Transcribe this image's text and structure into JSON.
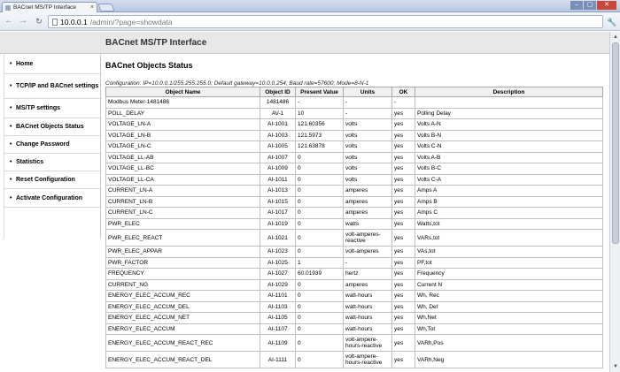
{
  "browser": {
    "tab_title": "BACnet MS/TP Interface",
    "tab_close": "×",
    "url_host": "10.0.0.1",
    "url_path": "/admin/?page=showdata",
    "back_icon": "←",
    "forward_icon": "→",
    "reload_icon": "↻",
    "wrench_icon": "🔧",
    "win_min": "–",
    "win_max": "▢",
    "win_close": "✕"
  },
  "header": {
    "brand": "BACnet MS/TP Interface"
  },
  "sidebar": {
    "items": [
      {
        "label": "Home"
      },
      {
        "label": "TCP/IP and BACnet settings"
      },
      {
        "label": "MS/TP settings"
      },
      {
        "label": "BACnet Objects Status"
      },
      {
        "label": "Change Password"
      },
      {
        "label": "Statistics"
      },
      {
        "label": "Reset Configuration"
      },
      {
        "label": "Activate Configuration"
      }
    ]
  },
  "main": {
    "title": "BACnet Objects Status",
    "configuration": "Configuration: IP=10.0.0.1/255.255.255.0; Default gateway=10.0.0.254; Baud rate=57600; Mode=8-N-1",
    "columns": [
      "Object Name",
      "Object ID",
      "Present Value",
      "Units",
      "OK",
      "Description"
    ],
    "rows": [
      [
        "Modbus Meter-1481486",
        "1481486",
        "-",
        "-",
        "-",
        ""
      ],
      [
        "POLL_DELAY",
        "AV-1",
        "10",
        "-",
        "yes",
        "Polling Delay"
      ],
      [
        "VOLTAGE_LN-A",
        "AI-1001",
        "121.60356",
        "volts",
        "yes",
        "Volts A-N"
      ],
      [
        "VOLTAGE_LN-B",
        "AI-1003",
        "121.5973",
        "volts",
        "yes",
        "Volts B-N"
      ],
      [
        "VOLTAGE_LN-C",
        "AI-1005",
        "121.63878",
        "volts",
        "yes",
        "Volts C-N"
      ],
      [
        "VOLTAGE_LL-AB",
        "AI-1007",
        "0",
        "volts",
        "yes",
        "Volts A-B"
      ],
      [
        "VOLTAGE_LL-BC",
        "AI-1009",
        "0",
        "volts",
        "yes",
        "Volts B-C"
      ],
      [
        "VOLTAGE_LL-CA",
        "AI-1011",
        "0",
        "volts",
        "yes",
        "Volts C-A"
      ],
      [
        "CURRENT_LN-A",
        "AI-1013",
        "0",
        "amperes",
        "yes",
        "Amps A"
      ],
      [
        "CURRENT_LN-B",
        "AI-1015",
        "0",
        "amperes",
        "yes",
        "Amps B"
      ],
      [
        "CURRENT_LN-C",
        "AI-1017",
        "0",
        "amperes",
        "yes",
        "Amps C"
      ],
      [
        "PWR_ELEC",
        "AI-1019",
        "0",
        "watts",
        "yes",
        "Watts,tot"
      ],
      [
        "PWR_ELEC_REACT",
        "AI-1021",
        "0",
        "volt-amperes-reactive",
        "yes",
        "VARs,tot"
      ],
      [
        "PWR_ELEC_APPAR",
        "AI-1023",
        "0",
        "volt-amperes",
        "yes",
        "VAs,tot"
      ],
      [
        "PWR_FACTOR",
        "AI-1025",
        "1",
        "-",
        "yes",
        "PF,tot"
      ],
      [
        "FREQUENCY",
        "AI-1027",
        "60.01939",
        "hertz",
        "yes",
        "Frequency"
      ],
      [
        "CURRENT_NG",
        "AI-1029",
        "0",
        "amperes",
        "yes",
        "Current N"
      ],
      [
        "ENERGY_ELEC_ACCUM_REC",
        "AI-1101",
        "0",
        "watt-hours",
        "yes",
        "Wh, Rec"
      ],
      [
        "ENERGY_ELEC_ACCUM_DEL",
        "AI-1103",
        "0",
        "watt-hours",
        "yes",
        "Wh, Del"
      ],
      [
        "ENERGY_ELEC_ACCUM_NET",
        "AI-1105",
        "0",
        "watt-hours",
        "yes",
        "Wh,Net"
      ],
      [
        "ENERGY_ELEC_ACCUM",
        "AI-1107",
        "0",
        "watt-hours",
        "yes",
        "Wh,Tot"
      ],
      [
        "ENERGY_ELEC_ACCUM_REACT_REC",
        "AI-1109",
        "0",
        "volt-ampere-hours-reactive",
        "yes",
        "VARh,Pos"
      ],
      [
        "ENERGY_ELEC_ACCUM_REACT_DEL",
        "AI-1111",
        "0",
        "volt-ampere-hours-reactive",
        "yes",
        "VARh,Neg"
      ]
    ]
  },
  "scrollbar": {
    "up_icon": "▲",
    "down_icon": "▼"
  }
}
